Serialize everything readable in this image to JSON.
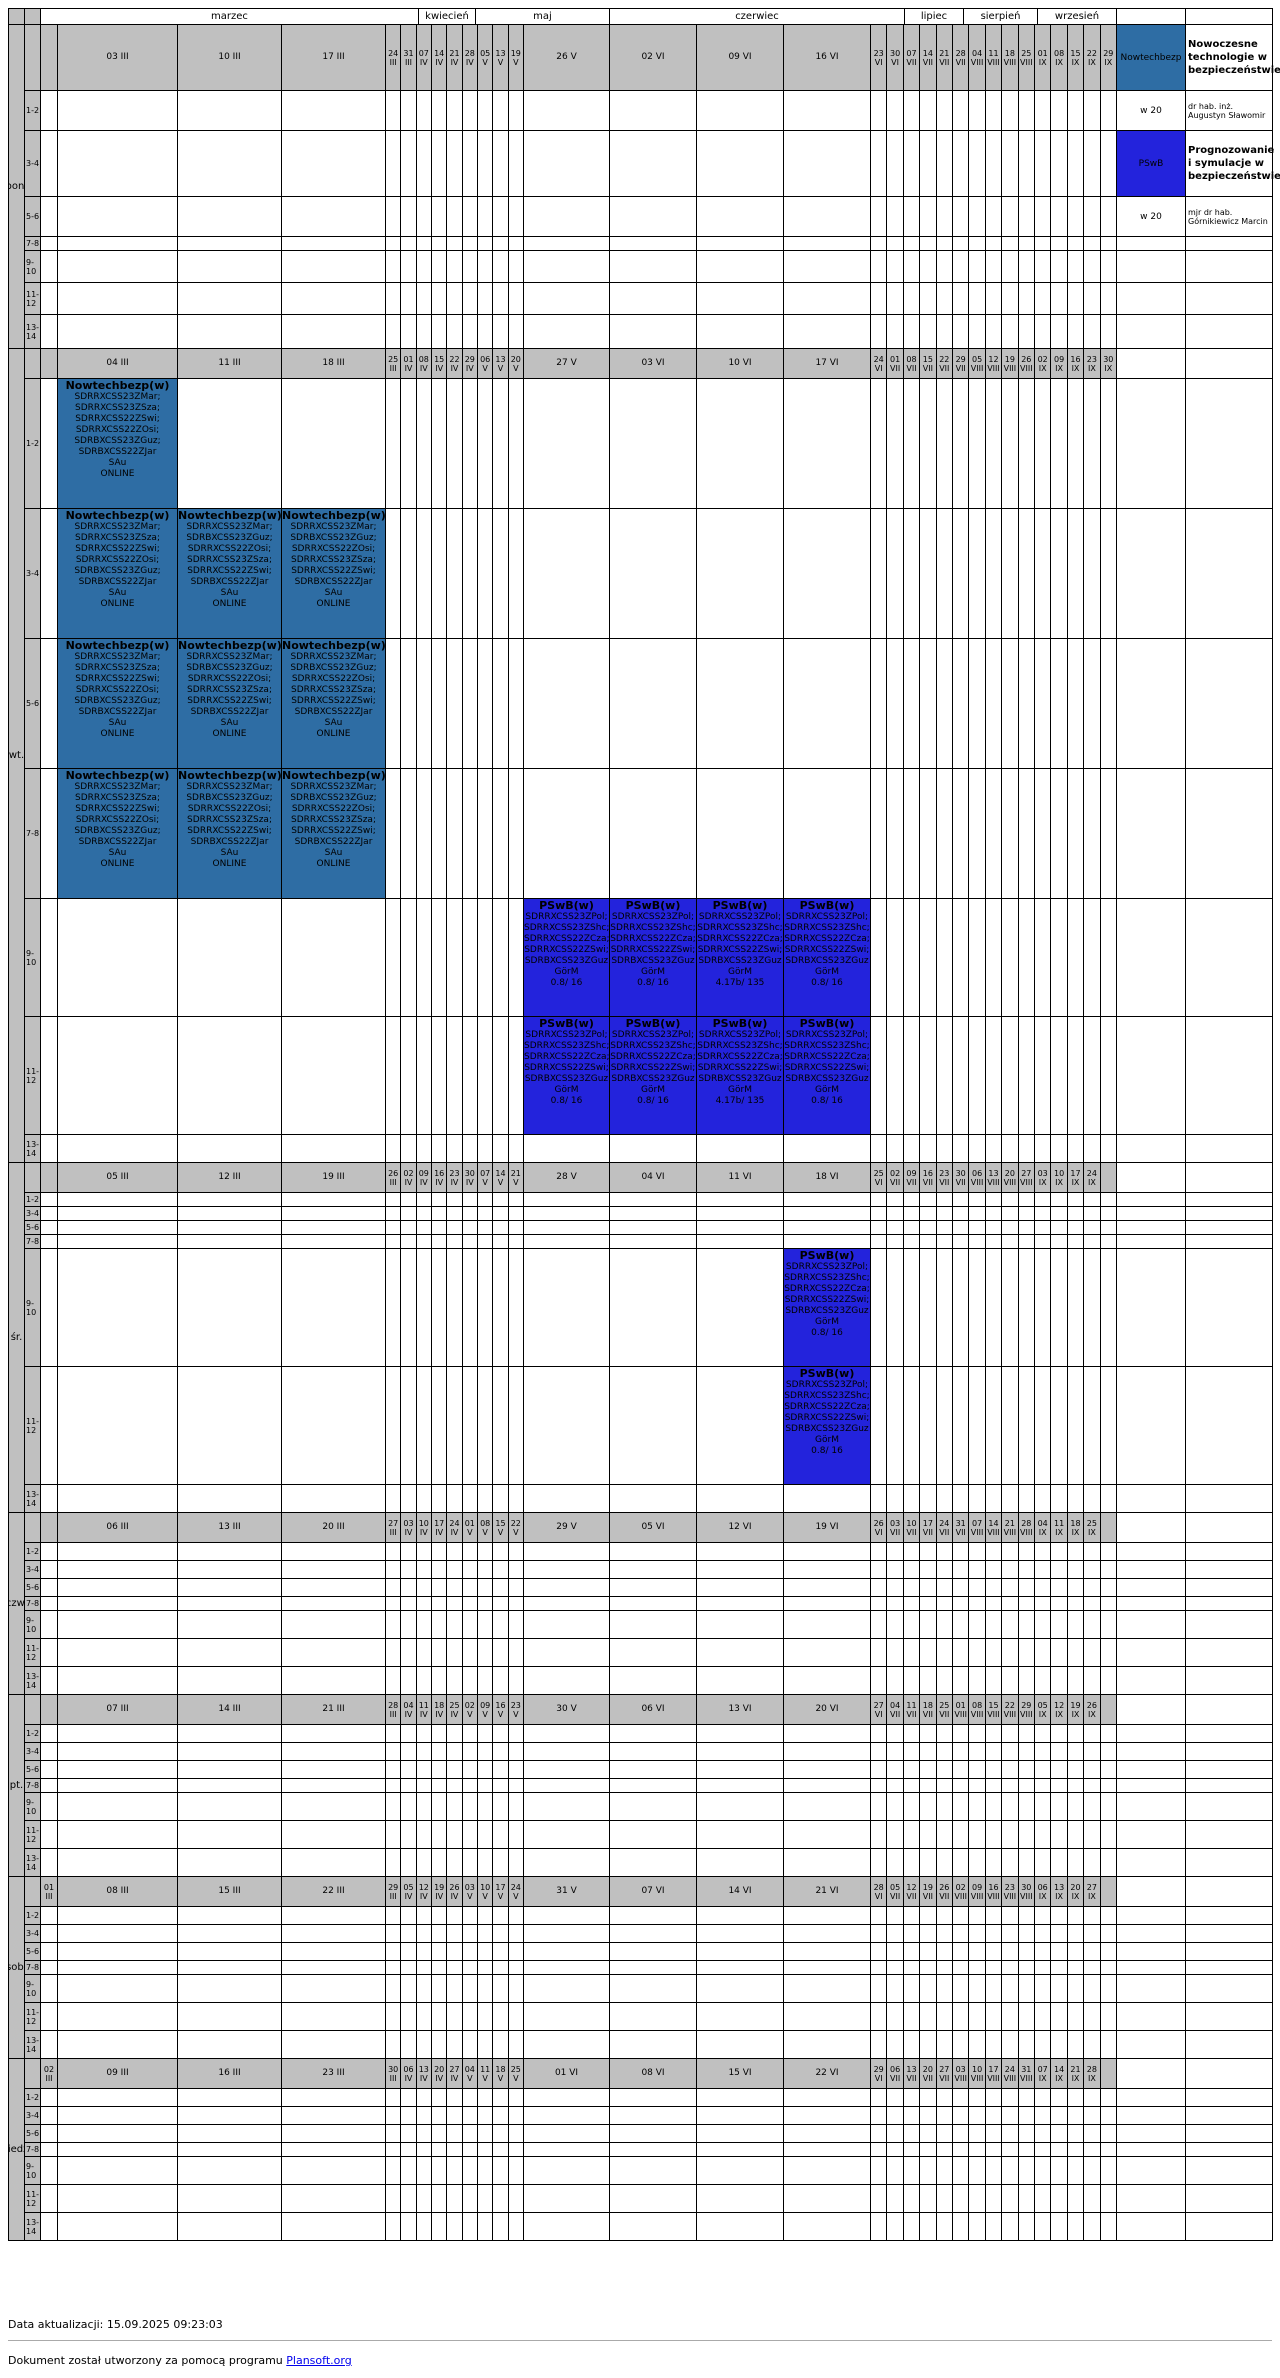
{
  "colors": {
    "nowtech": "#2e6da4",
    "pswb": "#2323dc",
    "header_gray": "#c0c0c0"
  },
  "months": [
    "marzec",
    "kwiecień",
    "maj",
    "czerwiec",
    "lipiec",
    "sierpień",
    "wrzesień"
  ],
  "slot_labels": [
    "1-2",
    "3-4",
    "5-6",
    "7-8",
    "9-10",
    "11-12",
    "13-14"
  ],
  "days": [
    {
      "label": "pon.",
      "extra": "",
      "wide": [
        "03 III",
        "10 III",
        "17 III"
      ],
      "narrow": [
        "24 III",
        "31 III",
        "07 IV",
        "14 IV",
        "21 IV",
        "28 IV",
        "05 V",
        "13 V",
        "19 V"
      ],
      "wide2": [
        "26 V",
        "02 VI",
        "09 VI",
        "16 VI"
      ],
      "narrow2": [
        "23 VI",
        "30 VI",
        "07 VII",
        "14 VII",
        "21 VII",
        "28 VII",
        "04 VIII",
        "11 VIII",
        "18 VIII",
        "25 VIII",
        "01 IX",
        "08 IX",
        "15 IX",
        "22 IX",
        "29 IX"
      ]
    },
    {
      "label": "wt.",
      "extra": "",
      "wide": [
        "04 III",
        "11 III",
        "18 III"
      ],
      "narrow": [
        "25 III",
        "01 IV",
        "08 IV",
        "15 IV",
        "22 IV",
        "29 IV",
        "06 V",
        "13 V",
        "20 V"
      ],
      "wide2": [
        "27 V",
        "03 VI",
        "10 VI",
        "17 VI"
      ],
      "narrow2": [
        "24 VI",
        "01 VII",
        "08 VII",
        "15 VII",
        "22 VII",
        "29 VII",
        "05 VIII",
        "12 VIII",
        "19 VIII",
        "26 VIII",
        "02 IX",
        "09 IX",
        "16 IX",
        "23 IX",
        "30 IX"
      ]
    },
    {
      "label": "śr.",
      "extra": "",
      "wide": [
        "05 III",
        "12 III",
        "19 III"
      ],
      "narrow": [
        "26 III",
        "02 IV",
        "09 IV",
        "16 IV",
        "23 IV",
        "30 IV",
        "07 V",
        "14 V",
        "21 V"
      ],
      "wide2": [
        "28 V",
        "04 VI",
        "11 VI",
        "18 VI"
      ],
      "narrow2": [
        "25 VI",
        "02 VII",
        "09 VII",
        "16 VII",
        "23 VII",
        "30 VII",
        "06 VIII",
        "13 VIII",
        "20 VIII",
        "27 VIII",
        "03 IX",
        "10 IX",
        "17 IX",
        "24 IX",
        ""
      ]
    },
    {
      "label": "czw.",
      "extra": "",
      "wide": [
        "06 III",
        "13 III",
        "20 III"
      ],
      "narrow": [
        "27 III",
        "03 IV",
        "10 IV",
        "17 IV",
        "24 IV",
        "01 V",
        "08 V",
        "15 V",
        "22 V"
      ],
      "wide2": [
        "29 V",
        "05 VI",
        "12 VI",
        "19 VI"
      ],
      "narrow2": [
        "26 VI",
        "03 VII",
        "10 VII",
        "17 VII",
        "24 VII",
        "31 VII",
        "07 VIII",
        "14 VIII",
        "21 VIII",
        "28 VIII",
        "04 IX",
        "11 IX",
        "18 IX",
        "25 IX",
        ""
      ]
    },
    {
      "label": "pt.",
      "extra": "",
      "wide": [
        "07 III",
        "14 III",
        "21 III"
      ],
      "narrow": [
        "28 III",
        "04 IV",
        "11 IV",
        "18 IV",
        "25 IV",
        "02 V",
        "09 V",
        "16 V",
        "23 V"
      ],
      "wide2": [
        "30 V",
        "06 VI",
        "13 VI",
        "20 VI"
      ],
      "narrow2": [
        "27 VI",
        "04 VII",
        "11 VII",
        "18 VII",
        "25 VII",
        "01 VIII",
        "08 VIII",
        "15 VIII",
        "22 VIII",
        "29 VIII",
        "05 IX",
        "12 IX",
        "19 IX",
        "26 IX",
        ""
      ]
    },
    {
      "label": "sob.",
      "extra": "01 III",
      "wide": [
        "08 III",
        "15 III",
        "22 III"
      ],
      "narrow": [
        "29 III",
        "05 IV",
        "12 IV",
        "19 IV",
        "26 IV",
        "03 V",
        "10 V",
        "17 V",
        "24 V"
      ],
      "wide2": [
        "31 V",
        "07 VI",
        "14 VI",
        "21 VI"
      ],
      "narrow2": [
        "28 VI",
        "05 VII",
        "12 VII",
        "19 VII",
        "26 VII",
        "02 VIII",
        "09 VIII",
        "16 VIII",
        "23 VIII",
        "30 VIII",
        "06 IX",
        "13 IX",
        "20 IX",
        "27 IX",
        ""
      ]
    },
    {
      "label": "niedz.",
      "extra": "02 III",
      "wide": [
        "09 III",
        "16 III",
        "23 III"
      ],
      "narrow": [
        "30 III",
        "06 IV",
        "13 IV",
        "20 IV",
        "27 IV",
        "04 V",
        "11 V",
        "18 V",
        "25 V"
      ],
      "wide2": [
        "01 VI",
        "08 VI",
        "15 VI",
        "22 VI"
      ],
      "narrow2": [
        "29 VI",
        "06 VII",
        "13 VII",
        "20 VII",
        "27 VII",
        "03 VIII",
        "10 VIII",
        "17 VIII",
        "24 VIII",
        "31 VIII",
        "07 IX",
        "14 IX",
        "21 IX",
        "28 IX",
        ""
      ]
    }
  ],
  "events": [
    {
      "day": 1,
      "slot": 0,
      "col": "w0",
      "kind": "nowtech",
      "title": "Nowtechbezp(w)",
      "lines": [
        "SDRRXCSS23ZMar;",
        "SDRRXCSS23ZSza;",
        "SDRRXCSS22ZSwi;",
        "SDRRXCSS22ZOsi;",
        "SDRBXCSS23ZGuz;",
        "SDRBXCSS22ZJar",
        "SAu",
        "ONLINE"
      ]
    },
    {
      "day": 1,
      "slot": 1,
      "col": "w0",
      "kind": "nowtech",
      "title": "Nowtechbezp(w)",
      "lines": [
        "SDRRXCSS23ZMar;",
        "SDRRXCSS23ZSza;",
        "SDRRXCSS22ZSwi;",
        "SDRRXCSS22ZOsi;",
        "SDRBXCSS23ZGuz;",
        "SDRBXCSS22ZJar",
        "SAu",
        "ONLINE"
      ]
    },
    {
      "day": 1,
      "slot": 1,
      "col": "w1",
      "kind": "nowtech",
      "title": "Nowtechbezp(w)",
      "lines": [
        "SDRRXCSS23ZMar;",
        "SDRBXCSS23ZGuz;",
        "SDRRXCSS22ZOsi;",
        "SDRRXCSS23ZSza;",
        "SDRRXCSS22ZSwi;",
        "SDRBXCSS22ZJar",
        "SAu",
        "ONLINE"
      ]
    },
    {
      "day": 1,
      "slot": 1,
      "col": "w2",
      "kind": "nowtech",
      "title": "Nowtechbezp(w)",
      "lines": [
        "SDRRXCSS23ZMar;",
        "SDRBXCSS23ZGuz;",
        "SDRRXCSS22ZOsi;",
        "SDRRXCSS23ZSza;",
        "SDRRXCSS22ZSwi;",
        "SDRBXCSS22ZJar",
        "SAu",
        "ONLINE"
      ]
    },
    {
      "day": 1,
      "slot": 2,
      "col": "w0",
      "kind": "nowtech",
      "title": "Nowtechbezp(w)",
      "lines": [
        "SDRRXCSS23ZMar;",
        "SDRRXCSS23ZSza;",
        "SDRRXCSS22ZSwi;",
        "SDRRXCSS22ZOsi;",
        "SDRBXCSS23ZGuz;",
        "SDRBXCSS22ZJar",
        "SAu",
        "ONLINE"
      ]
    },
    {
      "day": 1,
      "slot": 2,
      "col": "w1",
      "kind": "nowtech",
      "title": "Nowtechbezp(w)",
      "lines": [
        "SDRRXCSS23ZMar;",
        "SDRBXCSS23ZGuz;",
        "SDRRXCSS22ZOsi;",
        "SDRRXCSS23ZSza;",
        "SDRRXCSS22ZSwi;",
        "SDRBXCSS22ZJar",
        "SAu",
        "ONLINE"
      ]
    },
    {
      "day": 1,
      "slot": 2,
      "col": "w2",
      "kind": "nowtech",
      "title": "Nowtechbezp(w)",
      "lines": [
        "SDRRXCSS23ZMar;",
        "SDRBXCSS23ZGuz;",
        "SDRRXCSS22ZOsi;",
        "SDRRXCSS23ZSza;",
        "SDRRXCSS22ZSwi;",
        "SDRBXCSS22ZJar",
        "SAu",
        "ONLINE"
      ]
    },
    {
      "day": 1,
      "slot": 3,
      "col": "w0",
      "kind": "nowtech",
      "title": "Nowtechbezp(w)",
      "lines": [
        "SDRRXCSS23ZMar;",
        "SDRRXCSS23ZSza;",
        "SDRRXCSS22ZSwi;",
        "SDRRXCSS22ZOsi;",
        "SDRBXCSS23ZGuz;",
        "SDRBXCSS22ZJar",
        "SAu",
        "ONLINE"
      ]
    },
    {
      "day": 1,
      "slot": 3,
      "col": "w1",
      "kind": "nowtech",
      "title": "Nowtechbezp(w)",
      "lines": [
        "SDRRXCSS23ZMar;",
        "SDRBXCSS23ZGuz;",
        "SDRRXCSS22ZOsi;",
        "SDRRXCSS23ZSza;",
        "SDRRXCSS22ZSwi;",
        "SDRBXCSS22ZJar",
        "SAu",
        "ONLINE"
      ]
    },
    {
      "day": 1,
      "slot": 3,
      "col": "w2",
      "kind": "nowtech",
      "title": "Nowtechbezp(w)",
      "lines": [
        "SDRRXCSS23ZMar;",
        "SDRBXCSS23ZGuz;",
        "SDRRXCSS22ZOsi;",
        "SDRRXCSS23ZSza;",
        "SDRRXCSS22ZSwi;",
        "SDRBXCSS22ZJar",
        "SAu",
        "ONLINE"
      ]
    },
    {
      "day": 1,
      "slot": 4,
      "col": "v0",
      "kind": "pswb",
      "title": "PSwB(w)",
      "lines": [
        "SDRRXCSS23ZPol;",
        "SDRRXCSS23ZShc;",
        "SDRRXCSS22ZCza;",
        "SDRRXCSS22ZSwi;",
        "SDRBXCSS23ZGuz",
        "GörM",
        "0.8/ 16"
      ]
    },
    {
      "day": 1,
      "slot": 4,
      "col": "v1",
      "kind": "pswb",
      "title": "PSwB(w)",
      "lines": [
        "SDRRXCSS23ZPol;",
        "SDRRXCSS23ZShc;",
        "SDRRXCSS22ZCza;",
        "SDRRXCSS22ZSwi;",
        "SDRBXCSS23ZGuz",
        "GörM",
        "0.8/ 16"
      ]
    },
    {
      "day": 1,
      "slot": 4,
      "col": "v2",
      "kind": "pswb",
      "title": "PSwB(w)",
      "lines": [
        "SDRRXCSS23ZPol;",
        "SDRRXCSS23ZShc;",
        "SDRRXCSS22ZCza;",
        "SDRRXCSS22ZSwi;",
        "SDRBXCSS23ZGuz",
        "GörM",
        "4.17b/ 135"
      ]
    },
    {
      "day": 1,
      "slot": 4,
      "col": "v3",
      "kind": "pswb",
      "title": "PSwB(w)",
      "lines": [
        "SDRRXCSS23ZPol;",
        "SDRRXCSS23ZShc;",
        "SDRRXCSS22ZCza;",
        "SDRRXCSS22ZSwi;",
        "SDRBXCSS23ZGuz",
        "GörM",
        "0.8/ 16"
      ]
    },
    {
      "day": 1,
      "slot": 5,
      "col": "v0",
      "kind": "pswb",
      "title": "PSwB(w)",
      "lines": [
        "SDRRXCSS23ZPol;",
        "SDRRXCSS23ZShc;",
        "SDRRXCSS22ZCza;",
        "SDRRXCSS22ZSwi;",
        "SDRBXCSS23ZGuz",
        "GörM",
        "0.8/ 16"
      ]
    },
    {
      "day": 1,
      "slot": 5,
      "col": "v1",
      "kind": "pswb",
      "title": "PSwB(w)",
      "lines": [
        "SDRRXCSS23ZPol;",
        "SDRRXCSS23ZShc;",
        "SDRRXCSS22ZCza;",
        "SDRRXCSS22ZSwi;",
        "SDRBXCSS23ZGuz",
        "GörM",
        "0.8/ 16"
      ]
    },
    {
      "day": 1,
      "slot": 5,
      "col": "v2",
      "kind": "pswb",
      "title": "PSwB(w)",
      "lines": [
        "SDRRXCSS23ZPol;",
        "SDRRXCSS23ZShc;",
        "SDRRXCSS22ZCza;",
        "SDRRXCSS22ZSwi;",
        "SDRBXCSS23ZGuz",
        "GörM",
        "4.17b/ 135"
      ]
    },
    {
      "day": 1,
      "slot": 5,
      "col": "v3",
      "kind": "pswb",
      "title": "PSwB(w)",
      "lines": [
        "SDRRXCSS23ZPol;",
        "SDRRXCSS23ZShc;",
        "SDRRXCSS22ZCza;",
        "SDRRXCSS22ZSwi;",
        "SDRBXCSS23ZGuz",
        "GörM",
        "0.8/ 16"
      ]
    },
    {
      "day": 2,
      "slot": 4,
      "col": "v3",
      "kind": "pswb",
      "title": "PSwB(w)",
      "lines": [
        "SDRRXCSS23ZPol;",
        "SDRRXCSS23ZShc;",
        "SDRRXCSS22ZCza;",
        "SDRRXCSS22ZSwi;",
        "SDRBXCSS23ZGuz",
        "GörM",
        "0.8/ 16"
      ]
    },
    {
      "day": 2,
      "slot": 5,
      "col": "v3",
      "kind": "pswb",
      "title": "PSwB(w)",
      "lines": [
        "SDRRXCSS23ZPol;",
        "SDRRXCSS23ZShc;",
        "SDRRXCSS22ZCza;",
        "SDRRXCSS22ZSwi;",
        "SDRBXCSS23ZGuz",
        "GörM",
        "0.8/ 16"
      ]
    }
  ],
  "legend": [
    {
      "code": "Nowtechbezp",
      "kind": "nowtech",
      "name": "Nowoczesne technologie w bezpieczeństwie",
      "room": "w 20",
      "lecturer": "dr hab. inż. Augustyn Sławomir"
    },
    {
      "code": "PSwB",
      "kind": "pswb",
      "name": "Prognozowanie i symulacje w bezpieczeństwie",
      "room": "w 20",
      "lecturer": "mjr dr hab. Górnikiewicz Marcin"
    }
  ],
  "footer": {
    "updated": "Data aktualizacji: 15.09.2025 09:23:03",
    "created_prefix": "Dokument został utworzony za pomocą programu",
    "link": "Plansoft.org"
  }
}
